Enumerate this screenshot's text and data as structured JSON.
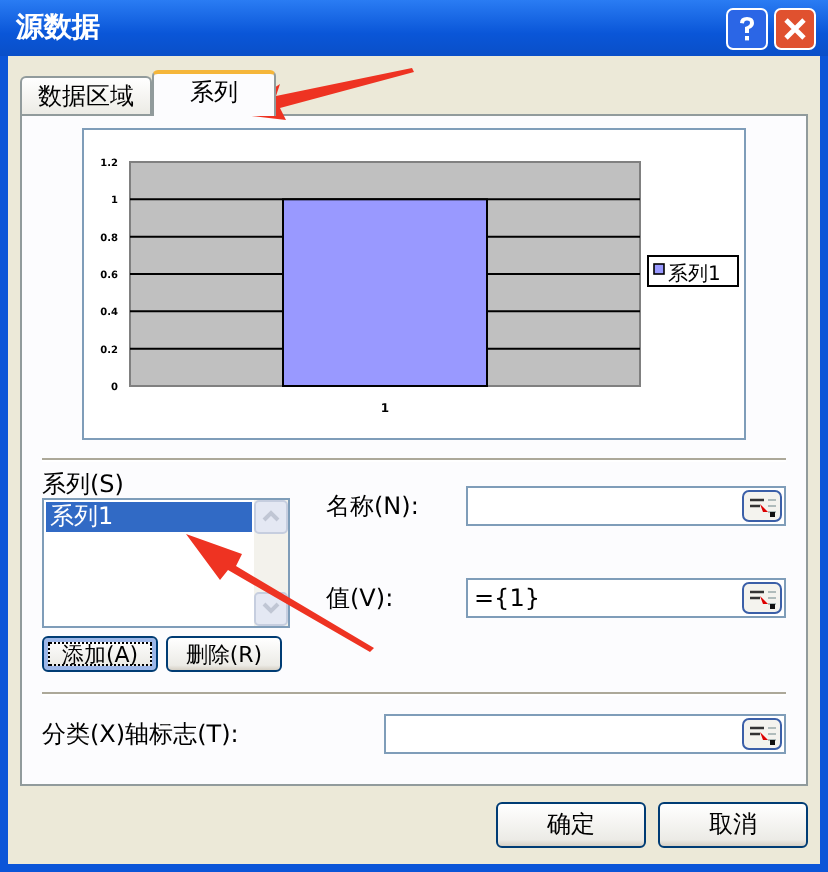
{
  "window": {
    "title": "源数据"
  },
  "tabs": [
    {
      "label": "数据区域",
      "selected": false
    },
    {
      "label": "系列",
      "selected": true
    }
  ],
  "preview": {
    "chart_data": {
      "type": "bar",
      "categories": [
        "1"
      ],
      "series": [
        {
          "name": "系列1",
          "color": "#9999ff",
          "values": [
            1
          ]
        }
      ],
      "grid": true,
      "ylim": [
        0,
        1.2
      ],
      "yticks": [
        0,
        0.2,
        0.4,
        0.6,
        0.8,
        1,
        1.2
      ]
    }
  },
  "series_list": {
    "label": "系列(S)",
    "items": [
      {
        "label": "系列1",
        "selected": true
      }
    ],
    "buttons": [
      {
        "label": "添加(A)",
        "focused": true
      },
      {
        "label": "删除(R)",
        "focused": false
      }
    ]
  },
  "fields": [
    {
      "label": "名称(N):"
    },
    {
      "label": "值(V):",
      "value": "={1}"
    }
  ],
  "category_axis": {
    "label": "分类(X)轴标志(T):"
  },
  "buttons": [
    "确定",
    "取消"
  ]
}
